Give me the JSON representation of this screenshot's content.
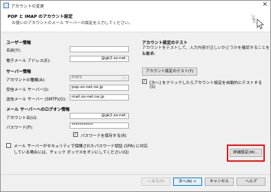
{
  "window": {
    "title": "アカウントの変更",
    "close_glyph": "✕"
  },
  "header": {
    "title": "POP と IMAP のアカウント設定",
    "subtitle": "お使いのアカウントのメール サーバーの設定を入力してください。"
  },
  "user_info": {
    "heading": "ユーザー情報",
    "name_label": "名前(Y):",
    "name_value": "",
    "email_label": "電子メール アドレス(E):",
    "email_value": "@gk2.so-net."
  },
  "server_info": {
    "heading": "サーバー情報",
    "account_type_label": "アカウントの種類(A):",
    "account_type_value": "POP3",
    "incoming_label": "受信メール サーバー(I):",
    "incoming_value": "pop.so-net.ne.jp",
    "outgoing_label": "送信メール サーバー (SMTP)(O):",
    "outgoing_value": "mail.so-net.ne.jp"
  },
  "logon_info": {
    "heading": "メール サーバーへのログオン情報",
    "account_name_label": "アカウント名(U):",
    "account_name_value": "@gk2.so-net.",
    "password_label": "パスワード(P):",
    "password_value": "***********",
    "remember_label": "パスワードを保存する(R)",
    "remember_checked": true,
    "spa_label_1": "メール サーバーがセキュリティで保護されたパスワード認証 (SPA) に対応",
    "spa_label_2": "している場合には、チェック ボックスをオンにしてください(Q)",
    "spa_checked": false
  },
  "test": {
    "heading": "アカウント設定のテスト",
    "desc_1": "アカウントをテストして、入力内容が正しいかどうかを確認することをお勧め",
    "desc_2": "します。",
    "test_button": "アカウント設定のテスト(T)",
    "auto_test_label_1": "[次へ] をクリックしたらアカウント設定を自動的にテストする",
    "auto_test_label_2": "(S)",
    "auto_test_checked": true
  },
  "buttons": {
    "more_settings": "詳細設定(M)...",
    "back": "< 戻る(B)",
    "next": "次へ(N) >",
    "cancel": "キャンセル",
    "help": "ヘルプ"
  },
  "colors": {
    "highlight": "#e01010",
    "primary_border": "#0078d7"
  },
  "icons": {
    "checkmark": "✓",
    "dropdown": "⌄"
  }
}
